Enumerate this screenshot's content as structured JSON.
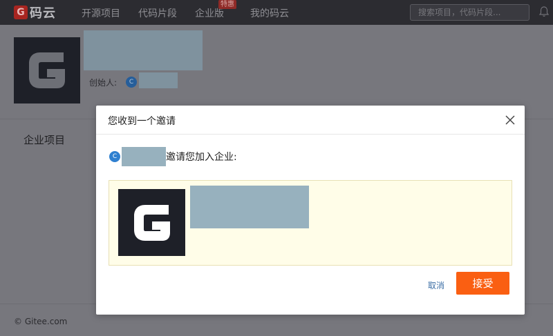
{
  "nav": {
    "brand_mark": "G",
    "brand_text": "码云",
    "links": [
      "开源项目",
      "代码片段",
      "企业版",
      "我的码云"
    ],
    "badge": "特惠",
    "search_placeholder": "搜索项目，代码片段..."
  },
  "org": {
    "creator_label": "创始人:",
    "creator_avatar_letter": "C"
  },
  "section": {
    "title": "企业项目"
  },
  "footer": {
    "copyright": "© Gitee.com"
  },
  "modal": {
    "title": "您收到一个邀请",
    "inviter_avatar_letter": "C",
    "invite_text": "邀请您加入企业:",
    "cancel_label": "取消",
    "accept_label": "接受"
  },
  "colors": {
    "accent": "#fa5f12",
    "link": "#3b6ea5",
    "card_bg": "#fffde8",
    "avatar": "#2f80d0"
  }
}
